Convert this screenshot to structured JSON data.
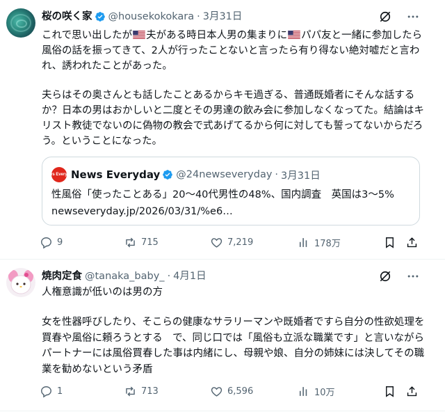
{
  "tweets": [
    {
      "author": {
        "name": "桜の咲く家",
        "handle": "@housekokokara",
        "date": "3月31日",
        "verified_icon": "verified-badge-icon"
      },
      "text_p1a": "これで思い出したが",
      "text_p1b": "夫がある時日本人男の集まりに",
      "text_p1c": "パパ友と一緒に参加したら風俗の話を振ってきて、2人が行ったことないと言ったら有り得ない絶対嘘だと言われ、誘われたことがあった。",
      "text_p2": "夫らはその奥さんとも話したことあるからキモ過ぎる、普通既婚者にそんな話するか？日本の男はおかしいと二度とその男達の飲み会に参加しなくなってた。結論はキリスト教徒でないのに偽物の教会で式あげてるから何に対しても誓ってないからだろう。ということになった。",
      "quote": {
        "logo_text": "News Everyday",
        "name": "News Everyday",
        "handle": "@24newseveryday",
        "date": "3月31日",
        "text": "性風俗「使ったことある」20～40代男性の48%、国内調査　英国は3～5%\nnewseveryday.jp/2026/03/31/%e6…"
      },
      "stats": {
        "replies": "9",
        "reposts": "715",
        "likes": "7,219",
        "views": "178万"
      }
    },
    {
      "author": {
        "name": "焼肉定食",
        "handle": "@tanaka_baby_",
        "date": "4月1日"
      },
      "text_p1": "人権意識が低いのは男の方",
      "text_p2": "女を性器呼びしたり、そこらの健康なサラリーマンや既婚者ですら自分の性欲処理を買春や風俗に頼ろうとする　で、同じ口では「風俗も立派な職業です」と言いながらパートナーには風俗買春した事は内緒にし、母親や娘、自分の姉妹には決してその職業を勧めないという矛盾",
      "stats": {
        "replies": "1",
        "reposts": "713",
        "likes": "6,596",
        "views": "10万"
      }
    }
  ],
  "colors": {
    "text": "#0f1419",
    "muted": "#536471",
    "verified": "#1d9bf0",
    "border": "#cfd9de",
    "divider": "#eff3f4",
    "news_red": "#e0261b"
  },
  "icons": [
    "grok-icon",
    "more-icon",
    "reply-icon",
    "repost-icon",
    "like-icon",
    "views-icon",
    "bookmark-icon",
    "share-icon",
    "us-flag-icon"
  ]
}
